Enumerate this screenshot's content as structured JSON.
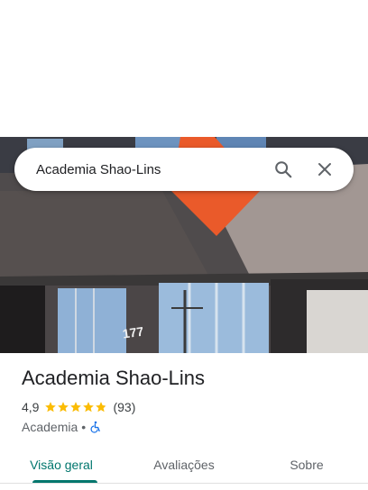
{
  "search": {
    "query": "Academia Shao-Lins"
  },
  "place": {
    "name": "Academia Shao-Lins",
    "rating": "4,9",
    "rating_fraction": 0.98,
    "review_count": "(93)",
    "category": "Academia",
    "separator": "•",
    "accessibility_icon": "wheelchair-icon",
    "star_color": "#fbbc04"
  },
  "photo": {
    "building_number": "177"
  },
  "tabs": [
    {
      "label": "Visão geral",
      "active": true
    },
    {
      "label": "Avaliações",
      "active": false
    },
    {
      "label": "Sobre",
      "active": false
    }
  ],
  "colors": {
    "accent": "#00766d",
    "accessibility": "#1a73e8"
  }
}
